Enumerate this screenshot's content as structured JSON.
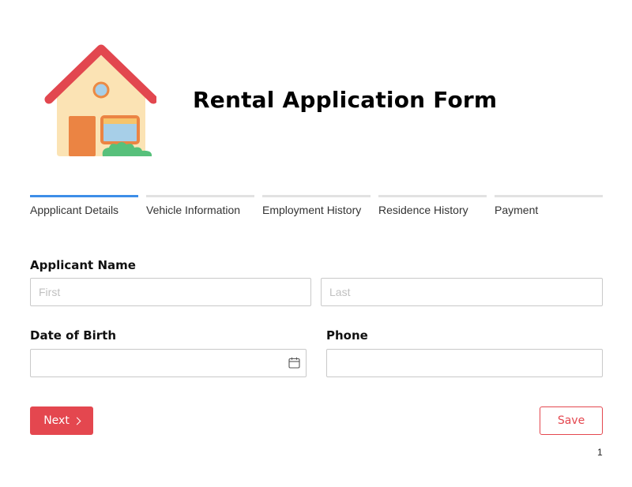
{
  "form": {
    "title": "Rental Application Form",
    "logo_icon": "house-icon"
  },
  "steps": [
    {
      "label": "Appplicant Details",
      "active": true
    },
    {
      "label": "Vehicle Information",
      "active": false
    },
    {
      "label": "Employment History",
      "active": false
    },
    {
      "label": "Residence History",
      "active": false
    },
    {
      "label": "Payment",
      "active": false
    }
  ],
  "fields": {
    "applicant_name_label": "Applicant Name",
    "first_placeholder": "First",
    "first_value": "",
    "last_placeholder": "Last",
    "last_value": "",
    "dob_label": "Date of Birth",
    "dob_value": "",
    "dob_icon": "calendar-icon",
    "phone_label": "Phone",
    "phone_value": ""
  },
  "buttons": {
    "next_label": "Next",
    "save_label": "Save"
  },
  "page_number": "1",
  "colors": {
    "accent": "#e4474f",
    "active_step": "#3d8ee8",
    "inactive_step": "#e2e2e2"
  }
}
